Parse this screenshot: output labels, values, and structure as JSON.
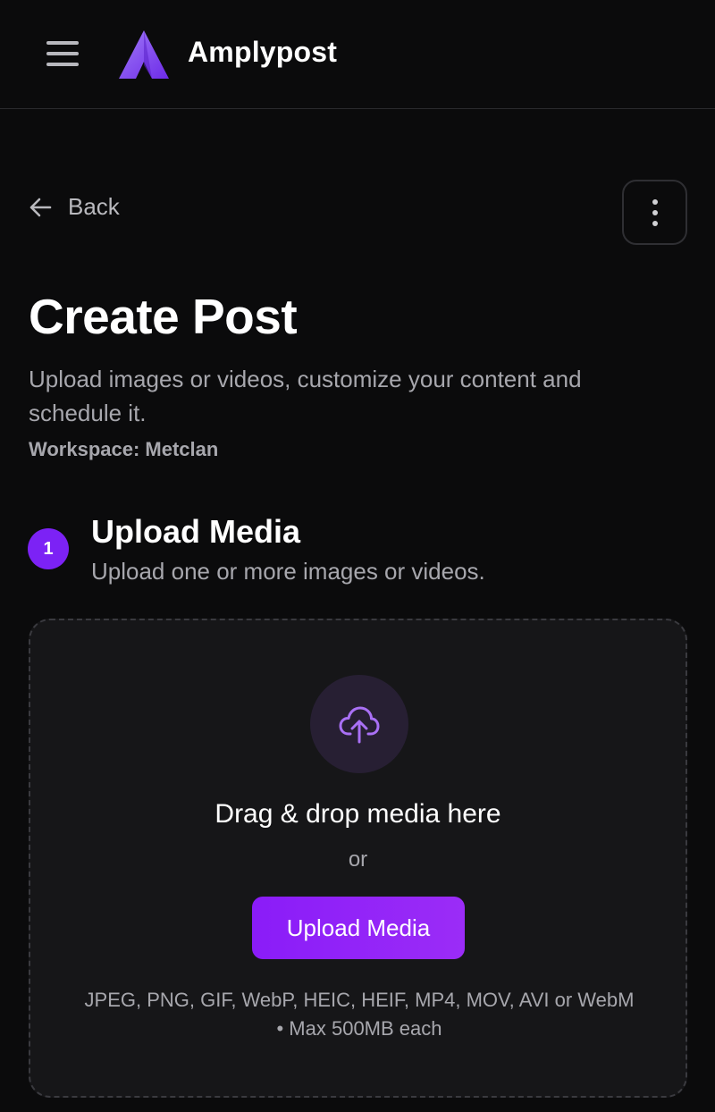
{
  "header": {
    "brand": "Amplypost"
  },
  "nav": {
    "back_label": "Back"
  },
  "page": {
    "title": "Create Post",
    "subtitle": "Upload images or videos, customize your content and schedule it.",
    "workspace": "Workspace: Metclan"
  },
  "step": {
    "number": "1",
    "title": "Upload Media",
    "subtitle": "Upload one or more images or videos."
  },
  "dropzone": {
    "title": "Drag & drop media here",
    "or": "or",
    "button_label": "Upload Media",
    "formats": "JPEG, PNG, GIF, WebP, HEIC, HEIF, MP4, MOV, AVI or WebM • Max 500MB each"
  },
  "icons": {
    "menu": "hamburger-menu-icon",
    "logo": "amplypost-logo-icon",
    "back": "arrow-left-icon",
    "more": "vertical-dots-icon",
    "upload": "cloud-upload-icon"
  },
  "colors": {
    "background": "#0b0b0c",
    "accent": "#7c22f5",
    "muted_text": "#a7a7ad",
    "dropzone_bg": "#161618"
  }
}
